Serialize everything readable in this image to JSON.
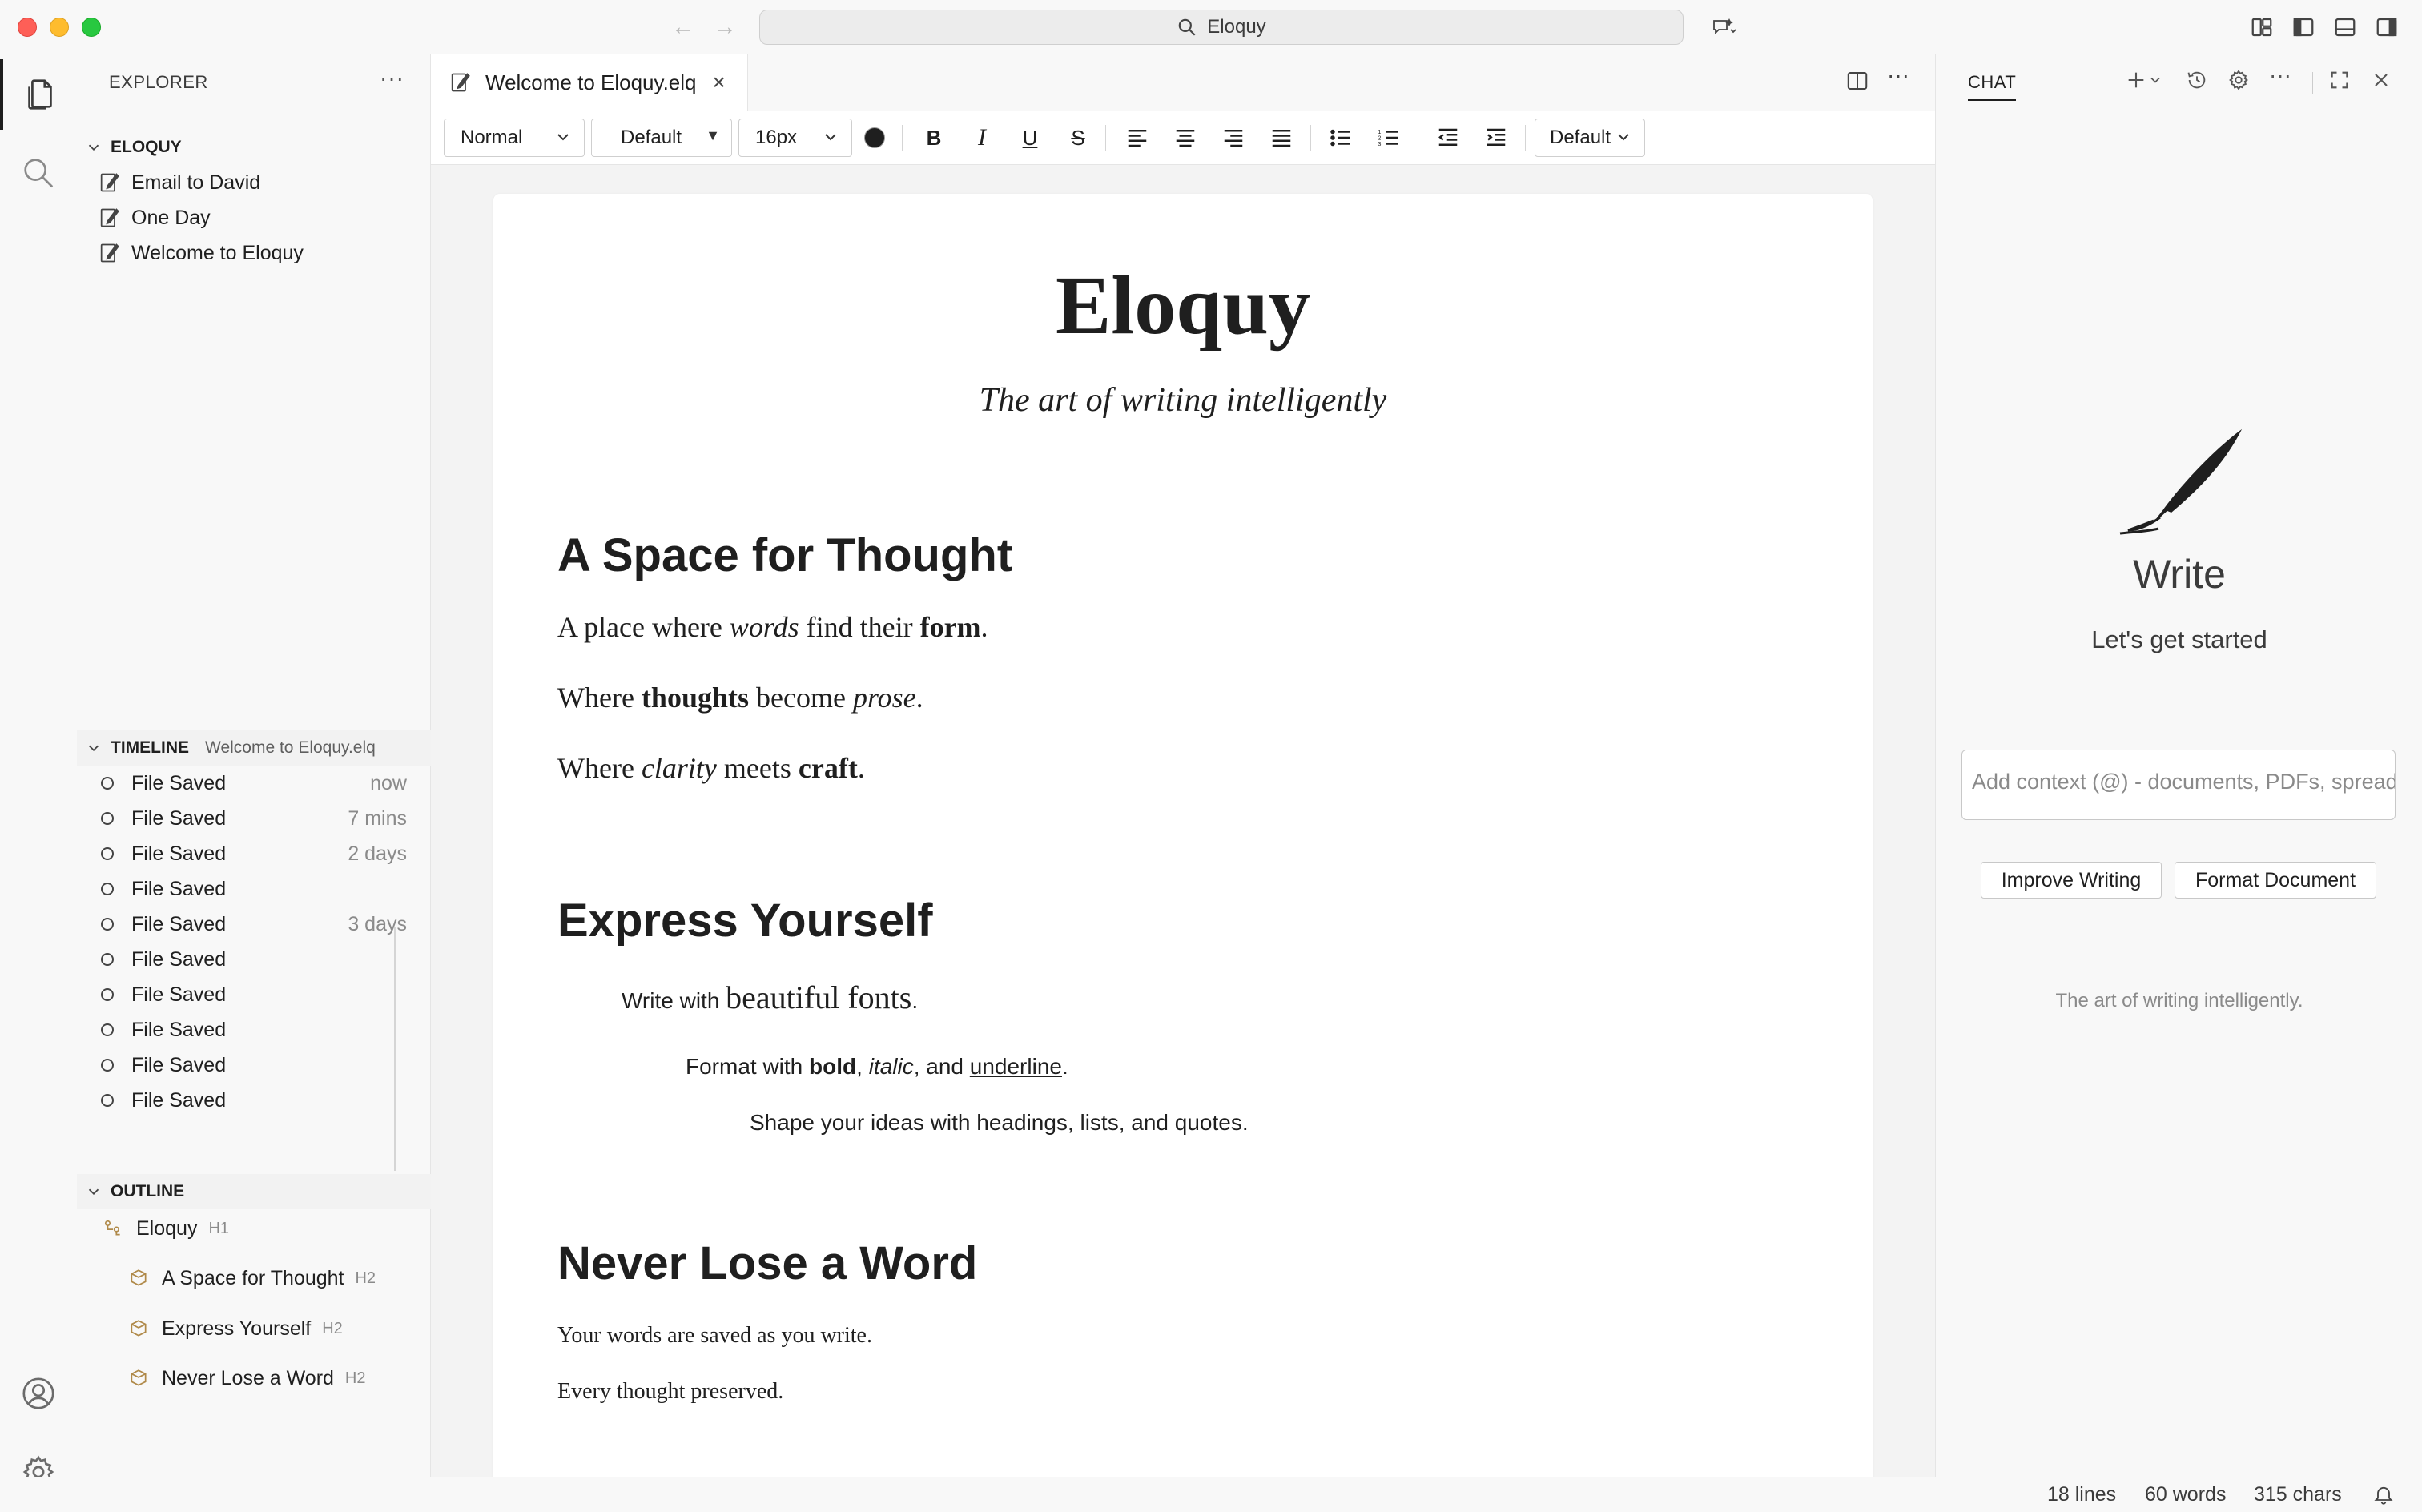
{
  "window": {
    "search_text": "Eloquy"
  },
  "activity": {
    "explorer": "files-icon",
    "search": "search-icon",
    "account": "account-icon",
    "settings": "gear-icon"
  },
  "sidebar": {
    "title": "EXPLORER",
    "more": "···",
    "workspace": {
      "label": "ELOQUY",
      "files": [
        "Email to David",
        "One Day",
        "Welcome to Eloquy"
      ]
    },
    "timeline": {
      "label": "TIMELINE",
      "file": "Welcome to Eloquy.elq",
      "items": [
        {
          "label": "File Saved",
          "when": "now"
        },
        {
          "label": "File Saved",
          "when": "7 mins"
        },
        {
          "label": "File Saved",
          "when": "2 days"
        },
        {
          "label": "File Saved",
          "when": ""
        },
        {
          "label": "File Saved",
          "when": "3 days"
        },
        {
          "label": "File Saved",
          "when": ""
        },
        {
          "label": "File Saved",
          "when": ""
        },
        {
          "label": "File Saved",
          "when": ""
        },
        {
          "label": "File Saved",
          "when": ""
        },
        {
          "label": "File Saved",
          "when": ""
        }
      ]
    },
    "outline": {
      "label": "OUTLINE",
      "items": [
        {
          "label": "Eloquy",
          "level": "H1"
        },
        {
          "label": "A Space for Thought",
          "level": "H2"
        },
        {
          "label": "Express Yourself",
          "level": "H2"
        },
        {
          "label": "Never Lose a Word",
          "level": "H2"
        }
      ]
    }
  },
  "editor": {
    "tab_label": "Welcome to Eloquy.elq",
    "tab_close": "×",
    "toolbar": {
      "block_style": "Normal",
      "font_family": "Default",
      "font_size": "16px",
      "line_height": "Default",
      "text_color": "#1f1f1f"
    },
    "doc": {
      "title": "Eloquy",
      "subtitle": "The art of writing intelligently",
      "s1_heading": "A Space for Thought",
      "s1_p1": {
        "a": "A place where ",
        "b": "words",
        "c": " find their ",
        "d": "form",
        "e": "."
      },
      "s1_p2": {
        "a": "Where ",
        "b": "thoughts",
        "c": " become ",
        "d": "prose",
        "e": "."
      },
      "s1_p3": {
        "a": "Where ",
        "b": "clarity",
        "c": " meets ",
        "d": "craft",
        "e": "."
      },
      "s2_heading": "Express Yourself",
      "s2_p1": {
        "a": "Write with ",
        "b": "beautiful fonts",
        "c": "."
      },
      "s2_p2": {
        "a": "Format with ",
        "b": "bold",
        "c": ", ",
        "d": "italic",
        "e": ", and ",
        "f": "underline",
        "g": "."
      },
      "s2_p3": "Shape your ideas with headings, lists, and quotes.",
      "s3_heading": "Never Lose a Word",
      "s3_p1": "Your words are saved as you write.",
      "s3_p2": "Every thought preserved."
    }
  },
  "chat": {
    "tab_label": "CHAT",
    "title": "Write",
    "subtitle": "Let's get started",
    "input_placeholder": "Add context (@) - documents, PDFs, spreadsheets",
    "buttons": [
      "Improve Writing",
      "Format Document"
    ],
    "footer": "The art of writing intelligently."
  },
  "status": {
    "lines": "18 lines",
    "words": "60 words",
    "chars": "315 chars"
  }
}
